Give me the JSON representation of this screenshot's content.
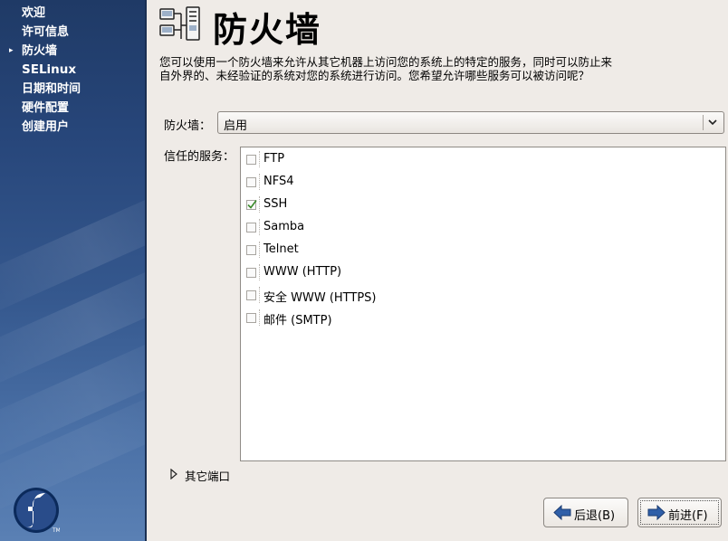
{
  "sidebar": {
    "items": [
      {
        "label": "欢迎",
        "active": false
      },
      {
        "label": "许可信息",
        "active": false
      },
      {
        "label": "防火墙",
        "active": true
      },
      {
        "label": "SELinux",
        "active": false
      },
      {
        "label": "日期和时间",
        "active": false
      },
      {
        "label": "硬件配置",
        "active": false
      },
      {
        "label": "创建用户",
        "active": false
      }
    ],
    "logo_icon": "fedora-logo-icon",
    "current_indicator_icon": "triangle-right-icon"
  },
  "header": {
    "title": "防火墙",
    "icon": "firewall-network-icon"
  },
  "description": "您可以使用一个防火墙来允许从其它机器上访问您的系统上的特定的服务，同时可以防止来自外界的、未经验证的系统对您的系统进行访问。您希望允许哪些服务可以被访问呢？",
  "firewall": {
    "label": "防火墙：",
    "selected": "启用"
  },
  "services": {
    "label": "信任的服务：",
    "items": [
      {
        "name": "FTP",
        "checked": false
      },
      {
        "name": "NFS4",
        "checked": false
      },
      {
        "name": "SSH",
        "checked": true
      },
      {
        "name": "Samba",
        "checked": false
      },
      {
        "name": "Telnet",
        "checked": false
      },
      {
        "name": "WWW (HTTP)",
        "checked": false
      },
      {
        "name": "安全 WWW (HTTPS)",
        "checked": false
      },
      {
        "name": "邮件 (SMTP)",
        "checked": false
      }
    ]
  },
  "other_ports": {
    "label": "其它端口"
  },
  "buttons": {
    "back_label": "后退(B)",
    "forward_label": "前进(F)"
  },
  "colors": {
    "sidebar_top": "#1f3a66",
    "sidebar_bottom": "#5a80b4",
    "window_bg": "#efebe7",
    "check_green": "#3a8a2a",
    "arrow_blue": "#2f5fa8"
  }
}
